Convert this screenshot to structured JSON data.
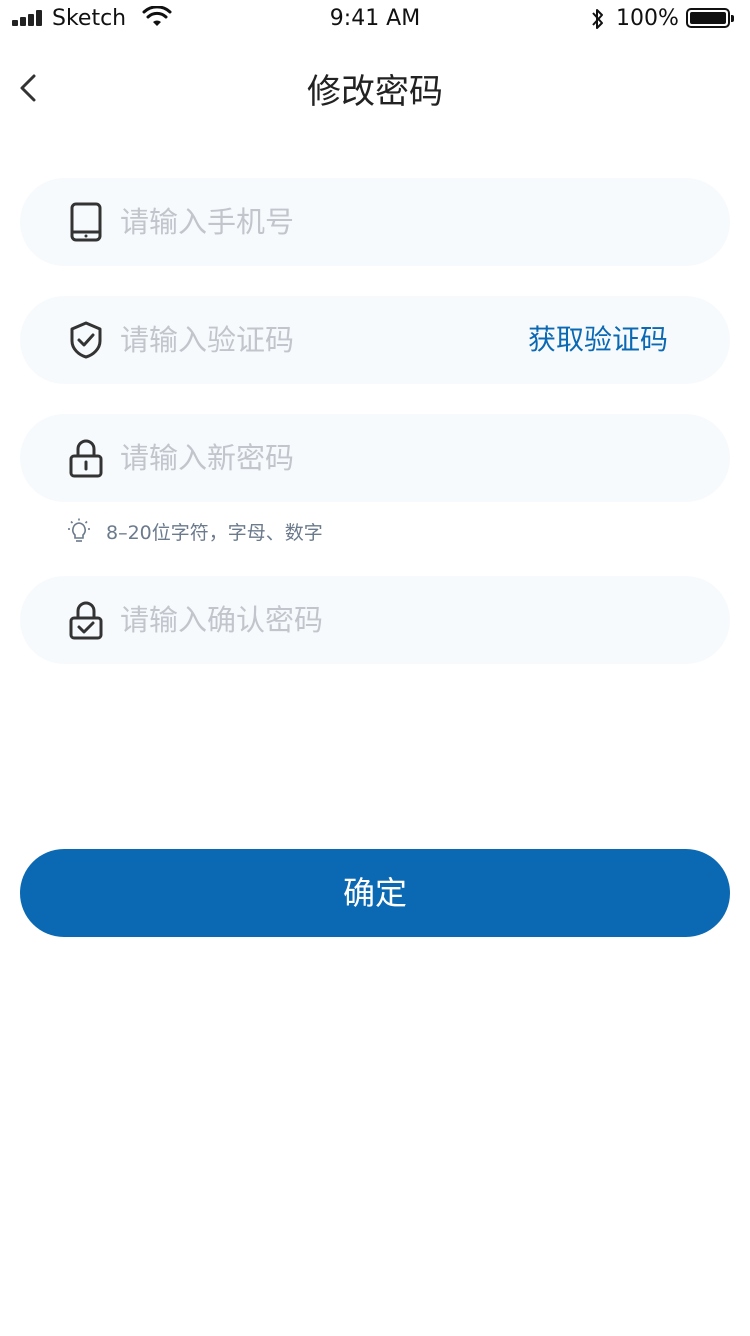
{
  "status_bar": {
    "carrier": "Sketch",
    "time": "9:41 AM",
    "battery": "100%"
  },
  "nav": {
    "title": "修改密码",
    "back_icon": "chevron-left-icon"
  },
  "form": {
    "phone": {
      "placeholder": "请输入手机号",
      "value": "",
      "icon": "phone-icon"
    },
    "code": {
      "placeholder": "请输入验证码",
      "value": "",
      "icon": "shield-check-icon",
      "action": "获取验证码"
    },
    "new_password": {
      "placeholder": "请输入新密码",
      "value": "",
      "icon": "lock-icon"
    },
    "hint": {
      "text": "8–20位字符，字母、数字",
      "icon": "lightbulb-icon"
    },
    "confirm_password": {
      "placeholder": "请输入确认密码",
      "value": "",
      "icon": "lock-check-icon"
    }
  },
  "submit": {
    "label": "确定"
  },
  "colors": {
    "primary": "#0b69b3",
    "field_bg": "#f7fafd",
    "placeholder": "#c2c6cc",
    "hint": "#6b7a8c"
  }
}
